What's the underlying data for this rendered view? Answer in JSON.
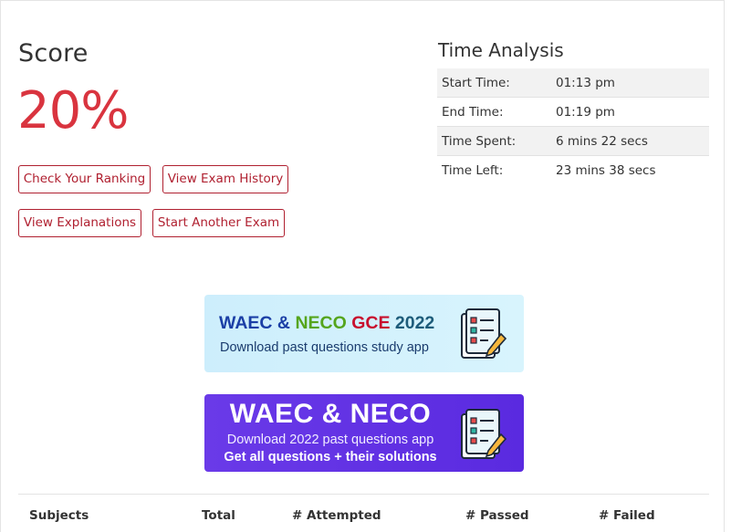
{
  "score": {
    "heading": "Score",
    "value": "20%"
  },
  "actions": {
    "check_ranking": "Check Your Ranking",
    "exam_history": "View Exam History",
    "explanations": "View Explanations",
    "another_exam": "Start Another Exam"
  },
  "time_analysis": {
    "title": "Time Analysis",
    "rows": [
      {
        "label": "Start Time:",
        "value": "01:13 pm"
      },
      {
        "label": "End Time:",
        "value": "01:19 pm"
      },
      {
        "label": "Time Spent:",
        "value": "6 mins 22 secs"
      },
      {
        "label": "Time Left:",
        "value": "23 mins 38 secs"
      }
    ]
  },
  "banner1": {
    "title_parts": [
      "WAEC",
      "&",
      "NECO",
      "GCE",
      "2022"
    ],
    "subtitle": "Download past questions study app",
    "icon": "checklist-pencil-icon"
  },
  "banner2": {
    "title": "WAEC & NECO",
    "subtitle1": "Download 2022 past questions app",
    "subtitle2": "Get all questions + their solutions",
    "icon": "checklist-pencil-icon"
  },
  "results_table": {
    "headers": [
      "Subjects",
      "Total",
      "# Attempted",
      "# Passed",
      "# Failed"
    ]
  },
  "colors": {
    "score": "#d9343f",
    "button_accent": "#b02030",
    "banner2_bg": "#5a2ae0"
  }
}
